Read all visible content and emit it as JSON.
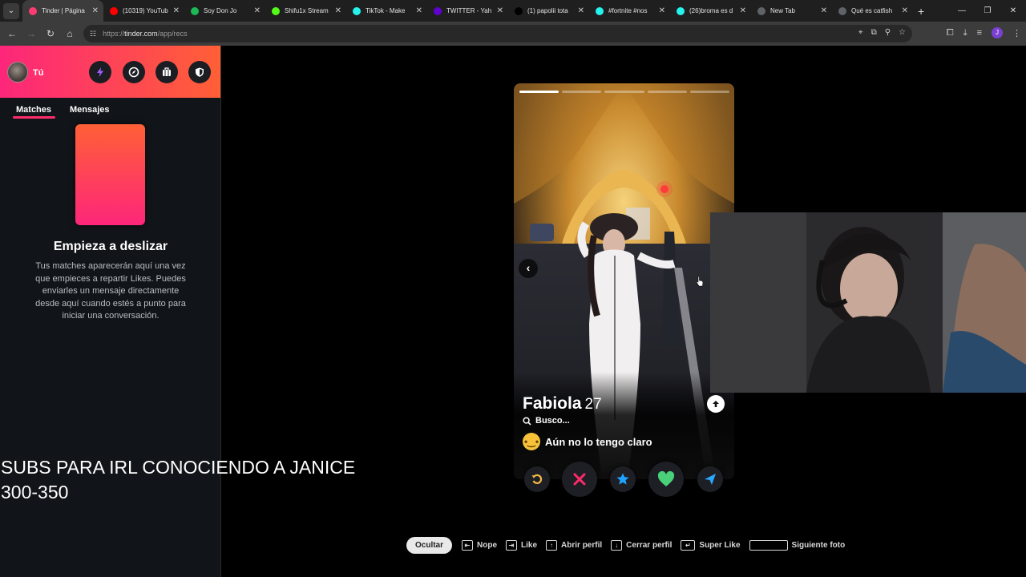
{
  "browser": {
    "tabs": [
      {
        "title": "Tinder | Página",
        "fav_color": "#fe3c72",
        "active": true
      },
      {
        "title": "(10319) YouTub",
        "fav_color": "#ff0000",
        "active": false
      },
      {
        "title": "Soy Don Jo",
        "fav_color": "#1db954",
        "active": false
      },
      {
        "title": "Shifu1x Stream",
        "fav_color": "#53fc18",
        "active": false
      },
      {
        "title": "TikTok - Make",
        "fav_color": "#25f4ee",
        "active": false
      },
      {
        "title": "TWITTER - Yah",
        "fav_color": "#6001d2",
        "active": false
      },
      {
        "title": "(1) papolii tota",
        "fav_color": "#000000",
        "active": false
      },
      {
        "title": "#fortnite #nos",
        "fav_color": "#25f4ee",
        "active": false
      },
      {
        "title": "(26)broma es d",
        "fav_color": "#25f4ee",
        "active": false
      },
      {
        "title": "New Tab",
        "fav_color": "#5f6368",
        "active": false
      },
      {
        "title": "Qué es catfish",
        "fav_color": "#5f6368",
        "active": false
      }
    ],
    "url": {
      "prefix": "https://",
      "host": "tinder.com",
      "path": "/app/recs"
    },
    "profile_initial": "J"
  },
  "sidebar": {
    "me_label": "Tú",
    "tabs": {
      "matches": "Matches",
      "messages": "Mensajes"
    },
    "empty_title": "Empieza a deslizar",
    "empty_desc": "Tus matches aparecerán aquí una vez que empieces a repartir Likes. Puedes enviarles un mensaje directamente desde aquí cuando estés a punto para iniciar una conversación."
  },
  "overlay": {
    "caption": "SUBS PARA IRL CONOCIENDO A JANICE\n300-350"
  },
  "profile": {
    "name": "Fabiola",
    "age": "27",
    "looking_for_label": "Busco...",
    "intent": "Aún no lo tengo claro",
    "photo_count": 5,
    "current_photo": 1
  },
  "hints": {
    "hide": "Ocultar",
    "nope": "Nope",
    "like": "Like",
    "open_profile": "Abrir perfil",
    "close_profile": "Cerrar perfil",
    "super_like": "Super Like",
    "next_photo": "Siguiente foto"
  },
  "colors": {
    "brand_start": "#fd267a",
    "brand_end": "#ff6036",
    "rewind": "#f5b748",
    "nope": "#fe2a6b",
    "super": "#1fa3ff",
    "like": "#4bd07a",
    "boost": "#2aa7ff"
  }
}
